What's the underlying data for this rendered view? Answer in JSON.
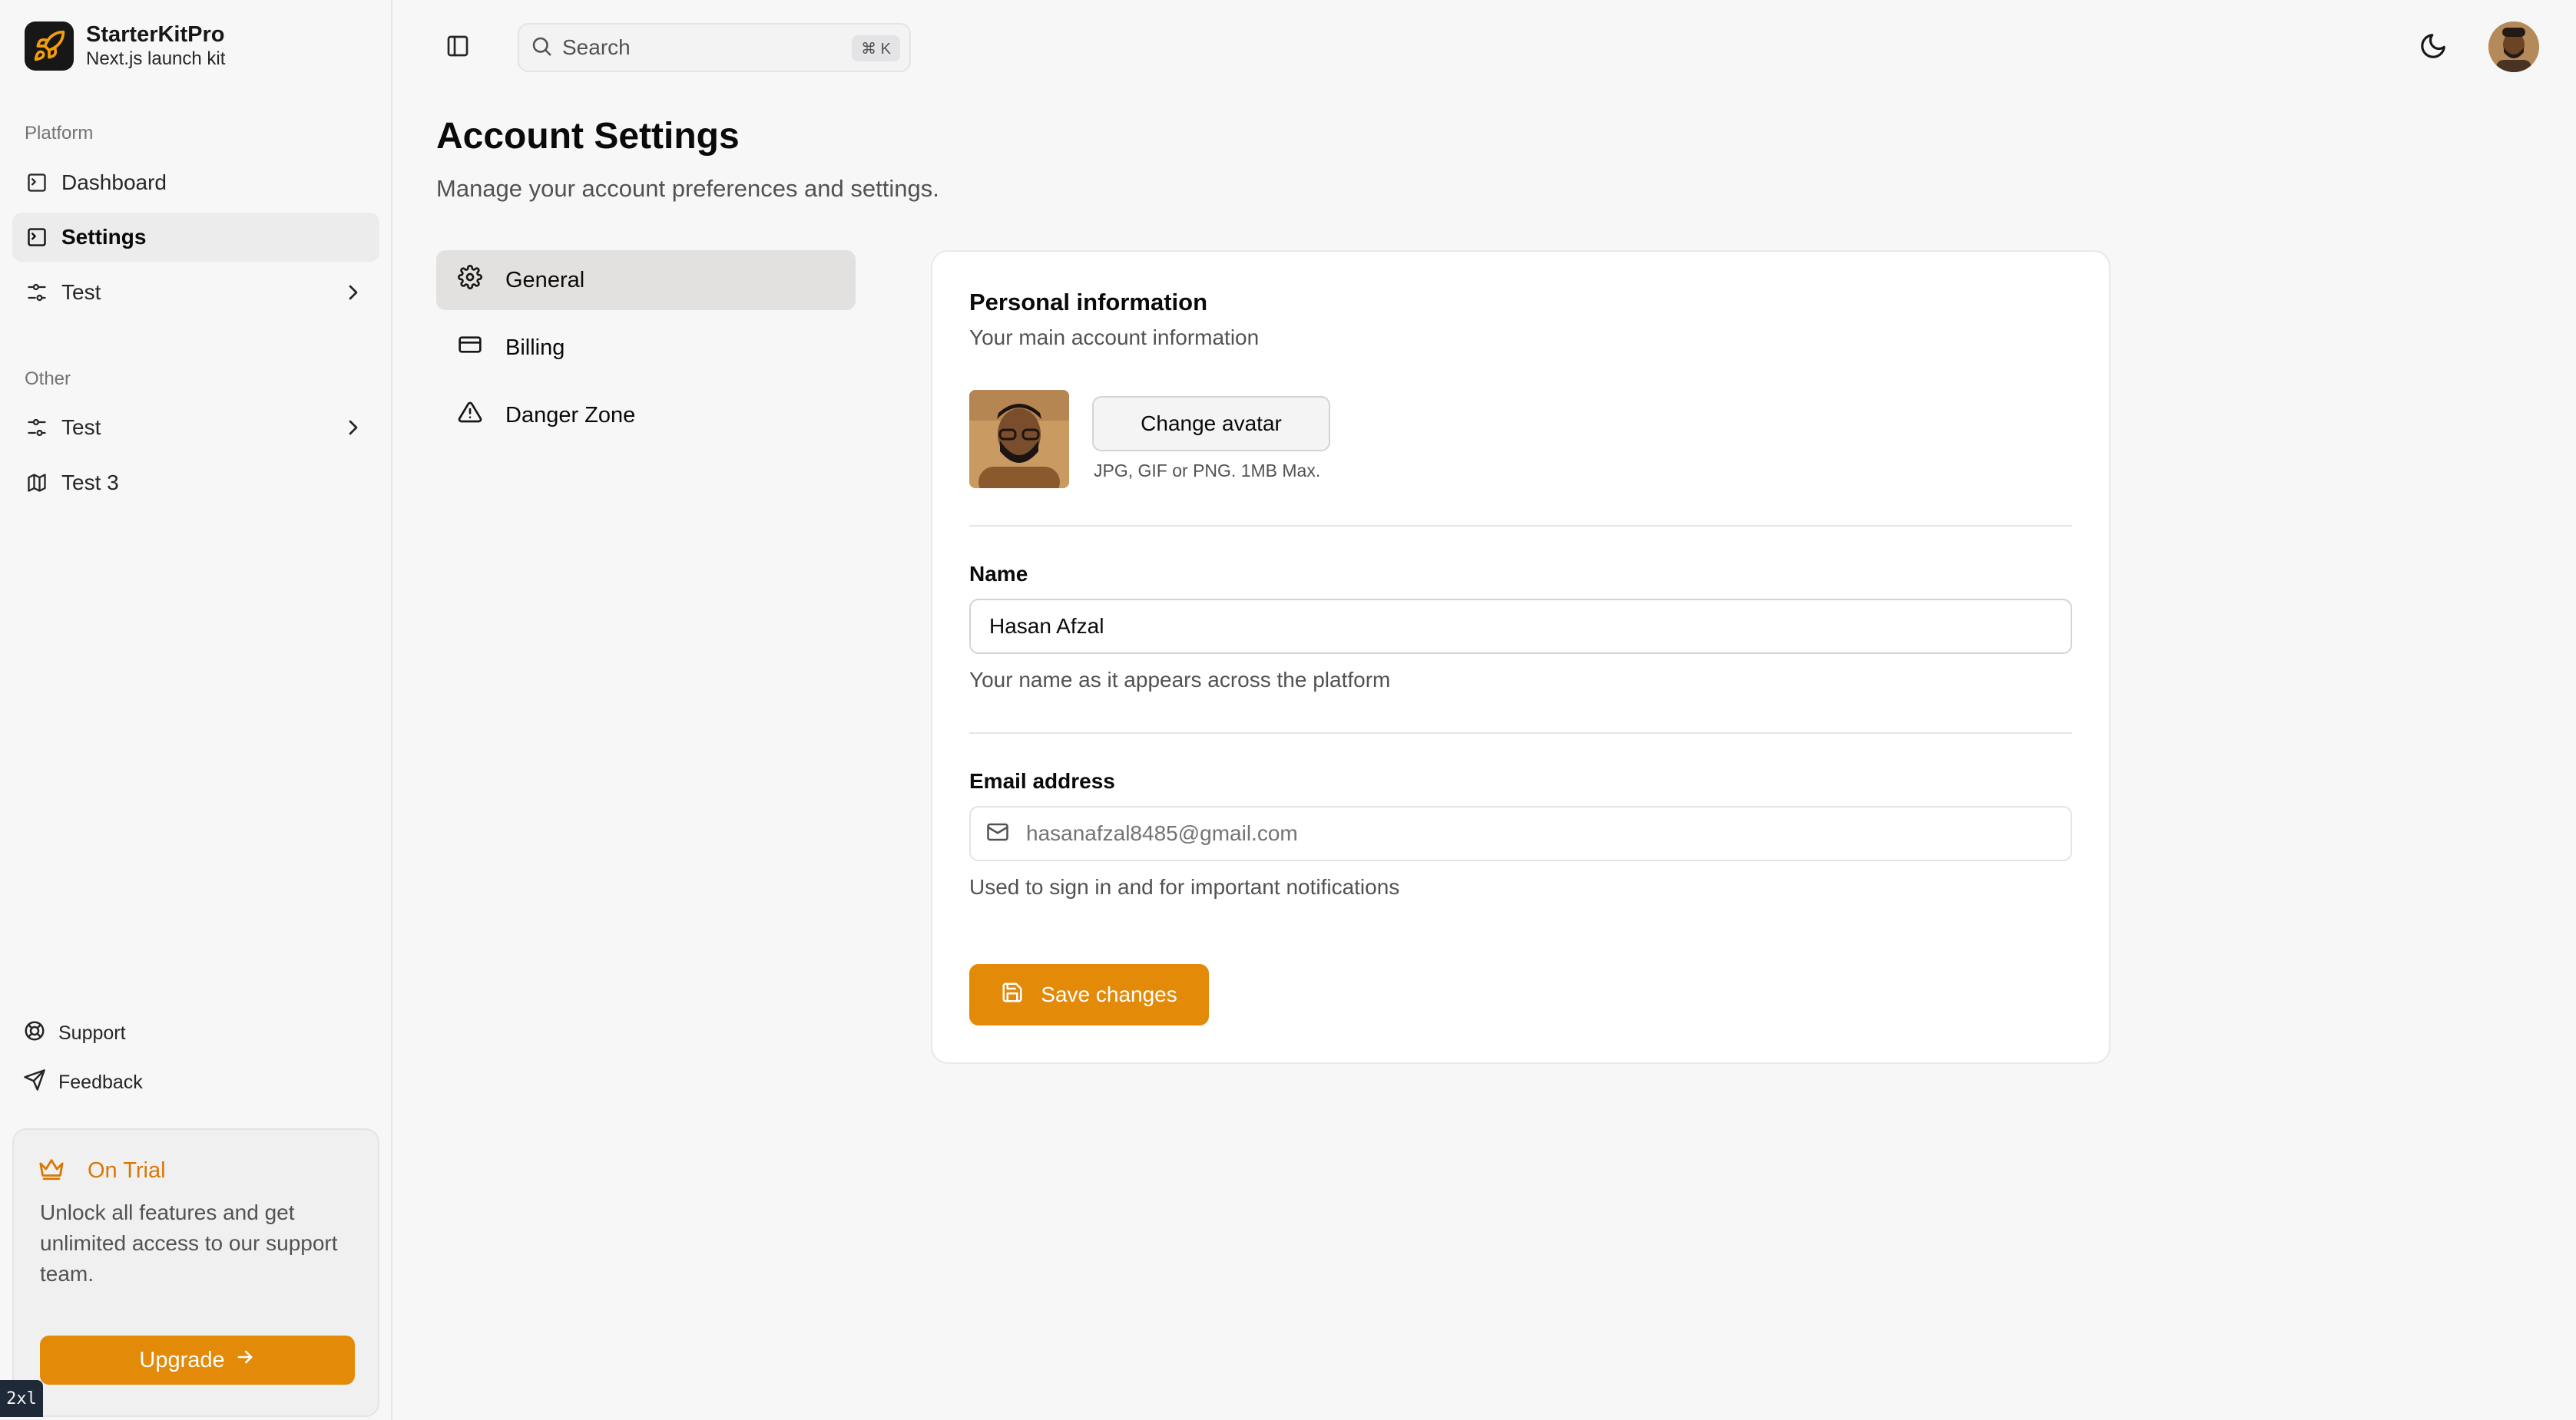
{
  "brand": {
    "name": "StarterKitPro",
    "tagline": "Next.js launch kit"
  },
  "sidebar": {
    "groups": [
      {
        "label": "Platform",
        "items": [
          {
            "label": "Dashboard",
            "icon": "terminal-square-icon"
          },
          {
            "label": "Settings",
            "icon": "terminal-square-icon",
            "active": true
          },
          {
            "label": "Test",
            "icon": "sliders-icon",
            "expandable": true
          }
        ]
      },
      {
        "label": "Other",
        "items": [
          {
            "label": "Test",
            "icon": "sliders-icon",
            "expandable": true
          },
          {
            "label": "Test 3",
            "icon": "map-icon"
          }
        ]
      }
    ],
    "footer_items": [
      {
        "label": "Support",
        "icon": "life-buoy-icon"
      },
      {
        "label": "Feedback",
        "icon": "send-icon"
      }
    ],
    "trial": {
      "title": "On Trial",
      "text": "Unlock all features and get unlimited access to our support team.",
      "button": "Upgrade"
    },
    "breakpoint_badge": "2xl"
  },
  "topbar": {
    "search_placeholder": "Search",
    "search_shortcut": "⌘ K"
  },
  "page": {
    "title": "Account Settings",
    "subtitle": "Manage your account preferences and settings."
  },
  "settings_nav": [
    {
      "label": "General",
      "icon": "gear-icon",
      "active": true
    },
    {
      "label": "Billing",
      "icon": "credit-card-icon"
    },
    {
      "label": "Danger Zone",
      "icon": "alert-triangle-icon"
    }
  ],
  "card": {
    "title": "Personal information",
    "subtitle": "Your main account information",
    "change_avatar": "Change avatar",
    "avatar_hint": "JPG, GIF or PNG. 1MB Max.",
    "name": {
      "label": "Name",
      "value": "Hasan Afzal",
      "help": "Your name as it appears across the platform"
    },
    "email": {
      "label": "Email address",
      "value": "hasanafzal8485@gmail.com",
      "help": "Used to sign in and for important notifications"
    },
    "save": "Save changes"
  },
  "colors": {
    "accent": "#e38a09",
    "trial_accent": "#d97706"
  }
}
